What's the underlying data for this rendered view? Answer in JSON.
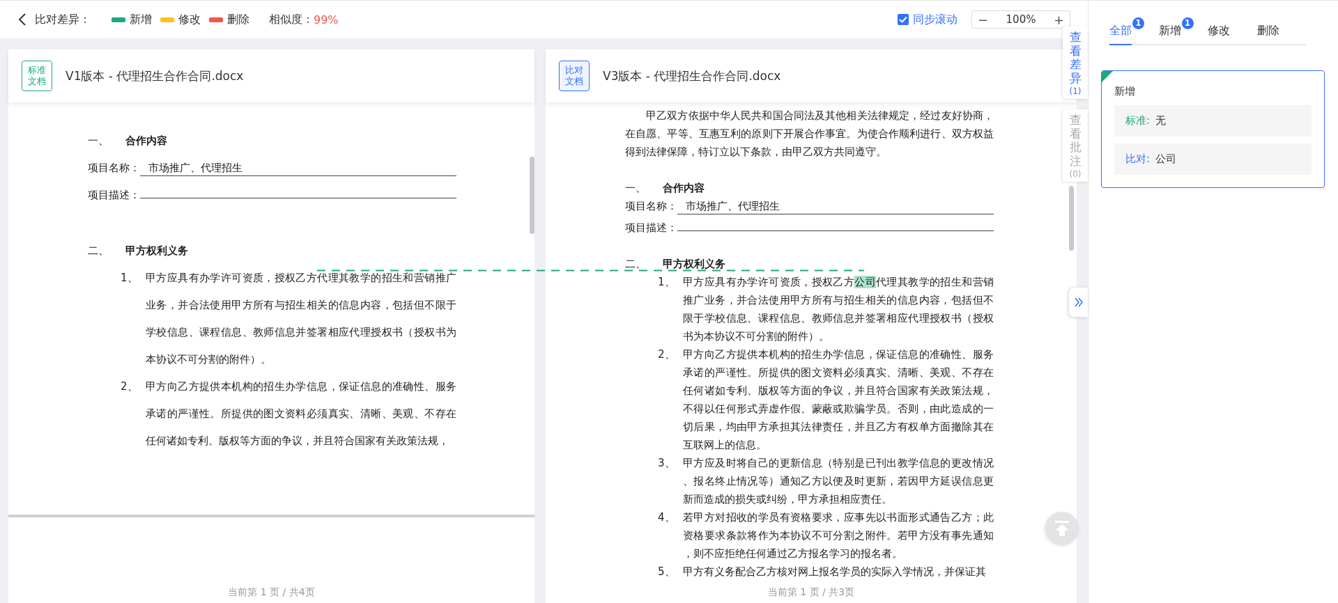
{
  "toolbar": {
    "title": "比对差异：",
    "legend": [
      {
        "label": "新增",
        "color": "#1aab78"
      },
      {
        "label": "修改",
        "color": "#fbc21b"
      },
      {
        "label": "删除",
        "color": "#f5544d"
      }
    ],
    "similarity_label": "相似度：",
    "similarity": "99%",
    "sync_scroll": {
      "label": "同步滚动",
      "checked": true
    },
    "zoom": {
      "minus": "−",
      "value": "100%",
      "plus": "+"
    }
  },
  "documents": [
    {
      "kind": "standard",
      "tag": "标准文档",
      "title": "V1版本 - 代理招生合作合同.docx",
      "footer": "当前第 1 页 / 共4页",
      "blocks": [
        {
          "kind": "heading",
          "number": "一、",
          "text": "合作内容"
        },
        {
          "kind": "field",
          "label": "项目名称：",
          "value": "市场推广、代理招生"
        },
        {
          "kind": "field",
          "label": "项目描述："
        },
        {
          "kind": "heading",
          "number": "二、",
          "text": "甲方权利义务"
        },
        {
          "kind": "item",
          "number": "1、",
          "parts": [
            {
              "text": "甲方应具有办学许可资质，授权乙方代理其教学的招生和营销推广业务，并合法使用甲方所有与招生相关的信息内容，包括但不限于学校信息、课程信息、教师信息并签署相应代理授权书（授权书为本协议不可分割的附件）。",
              "kind": "plain"
            }
          ]
        },
        {
          "kind": "item",
          "number": "2、",
          "parts": [
            {
              "text": "甲方向乙方提供本机构的招生办学信息，保证信息的准确性、服务承诺的严谨性。所提供的图文资料必须真实、清晰、美观、不存在任何诸如专利、版权等方面的争议，并且符合国家有关政策法规，",
              "kind": "plain"
            }
          ]
        },
        {
          "kind": "page_break"
        }
      ]
    },
    {
      "kind": "compare",
      "tag": "比对文档",
      "title": "V3版本 - 代理招生合作合同.docx",
      "footer": "当前第 1 页 / 共3页",
      "blocks": [
        {
          "kind": "paragraph",
          "text": "甲乙双方依据中华人民共和国合同法及其他相关法律规定，经过友好协商，在自愿、平等、互惠互利的原则下开展合作事宜。为使合作顺利进行、双方权益得到法律保障，特订立以下条款，由甲乙双方共同遵守。"
        },
        {
          "kind": "heading",
          "number": "一、",
          "text": "合作内容"
        },
        {
          "kind": "field",
          "label": "项目名称：",
          "value": "市场推广、代理招生"
        },
        {
          "kind": "field",
          "label": "项目描述："
        },
        {
          "kind": "heading",
          "number": "二、",
          "text": "甲方权利义务"
        },
        {
          "kind": "item",
          "number": "1、",
          "parts": [
            {
              "text": "甲方应具有办学许可资质，授权乙方",
              "kind": "plain"
            },
            {
              "text": "公司",
              "kind": "added"
            },
            {
              "text": "代理其教学的招生和营销推广业务，并合法使用甲方所有与招生相关的信息内容，包括但不限于学校信息、课程信息、教师信息并签署相应代理授权书（授权书为本协议不可分割的附件）。",
              "kind": "plain"
            }
          ]
        },
        {
          "kind": "item",
          "number": "2、",
          "parts": [
            {
              "text": "甲方向乙方提供本机构的招生办学信息，保证信息的准确性、服务承诺的严谨性。所提供的图文资料必须真实、清晰、美观、不存在任何诸如专利、版权等方面的争议，并且符合国家有关政策法规，不得以任何形式弄虚作假、蒙蔽或欺骗学员。否则，由此造成的一切后果，均由甲方承担其法律责任，并且乙方有权单方面撤除其在互联网上的信息。",
              "kind": "plain"
            }
          ]
        },
        {
          "kind": "item",
          "number": "3、",
          "parts": [
            {
              "text": "甲方应及时将自己的更新信息（特别是已刊出教学信息的更改情况、报名终止情况等）通知乙方以便及时更新，若因甲方延误信息更新而造成的损失或纠纷，甲方承担相应责任。",
              "kind": "plain"
            }
          ]
        },
        {
          "kind": "item",
          "number": "4、",
          "parts": [
            {
              "text": "若甲方对招收的学员有资格要求，应事先以书面形式通告乙方；此资格要求条款将作为本协议不可分割之附件。若甲方没有事先通知，则不应拒绝任何通过乙方报名学习的报名者。",
              "kind": "plain"
            }
          ]
        },
        {
          "kind": "item",
          "number": "5、",
          "parts": [
            {
              "text": "甲方有义务配合乙方核对网上报名学员的实际入学情况，并保证其",
              "kind": "plain"
            }
          ]
        }
      ]
    }
  ],
  "side_tabs": [
    {
      "label": "查看差异",
      "count": "(1)",
      "selected": true
    },
    {
      "label": "查看批注",
      "count": "(0)",
      "selected": false
    }
  ],
  "diff_panel": {
    "tabs": [
      {
        "label": "全部",
        "badge": "1",
        "selected": true
      },
      {
        "label": "新增",
        "badge": "1",
        "selected": false
      },
      {
        "label": "修改",
        "selected": false
      },
      {
        "label": "删除",
        "selected": false
      }
    ],
    "cards": [
      {
        "kind": "added",
        "title": "新增",
        "rows": [
          {
            "kind": "standard",
            "label": "标准:",
            "value": "无"
          },
          {
            "kind": "compare",
            "label": "比对:",
            "value": "公司"
          }
        ]
      }
    ]
  }
}
